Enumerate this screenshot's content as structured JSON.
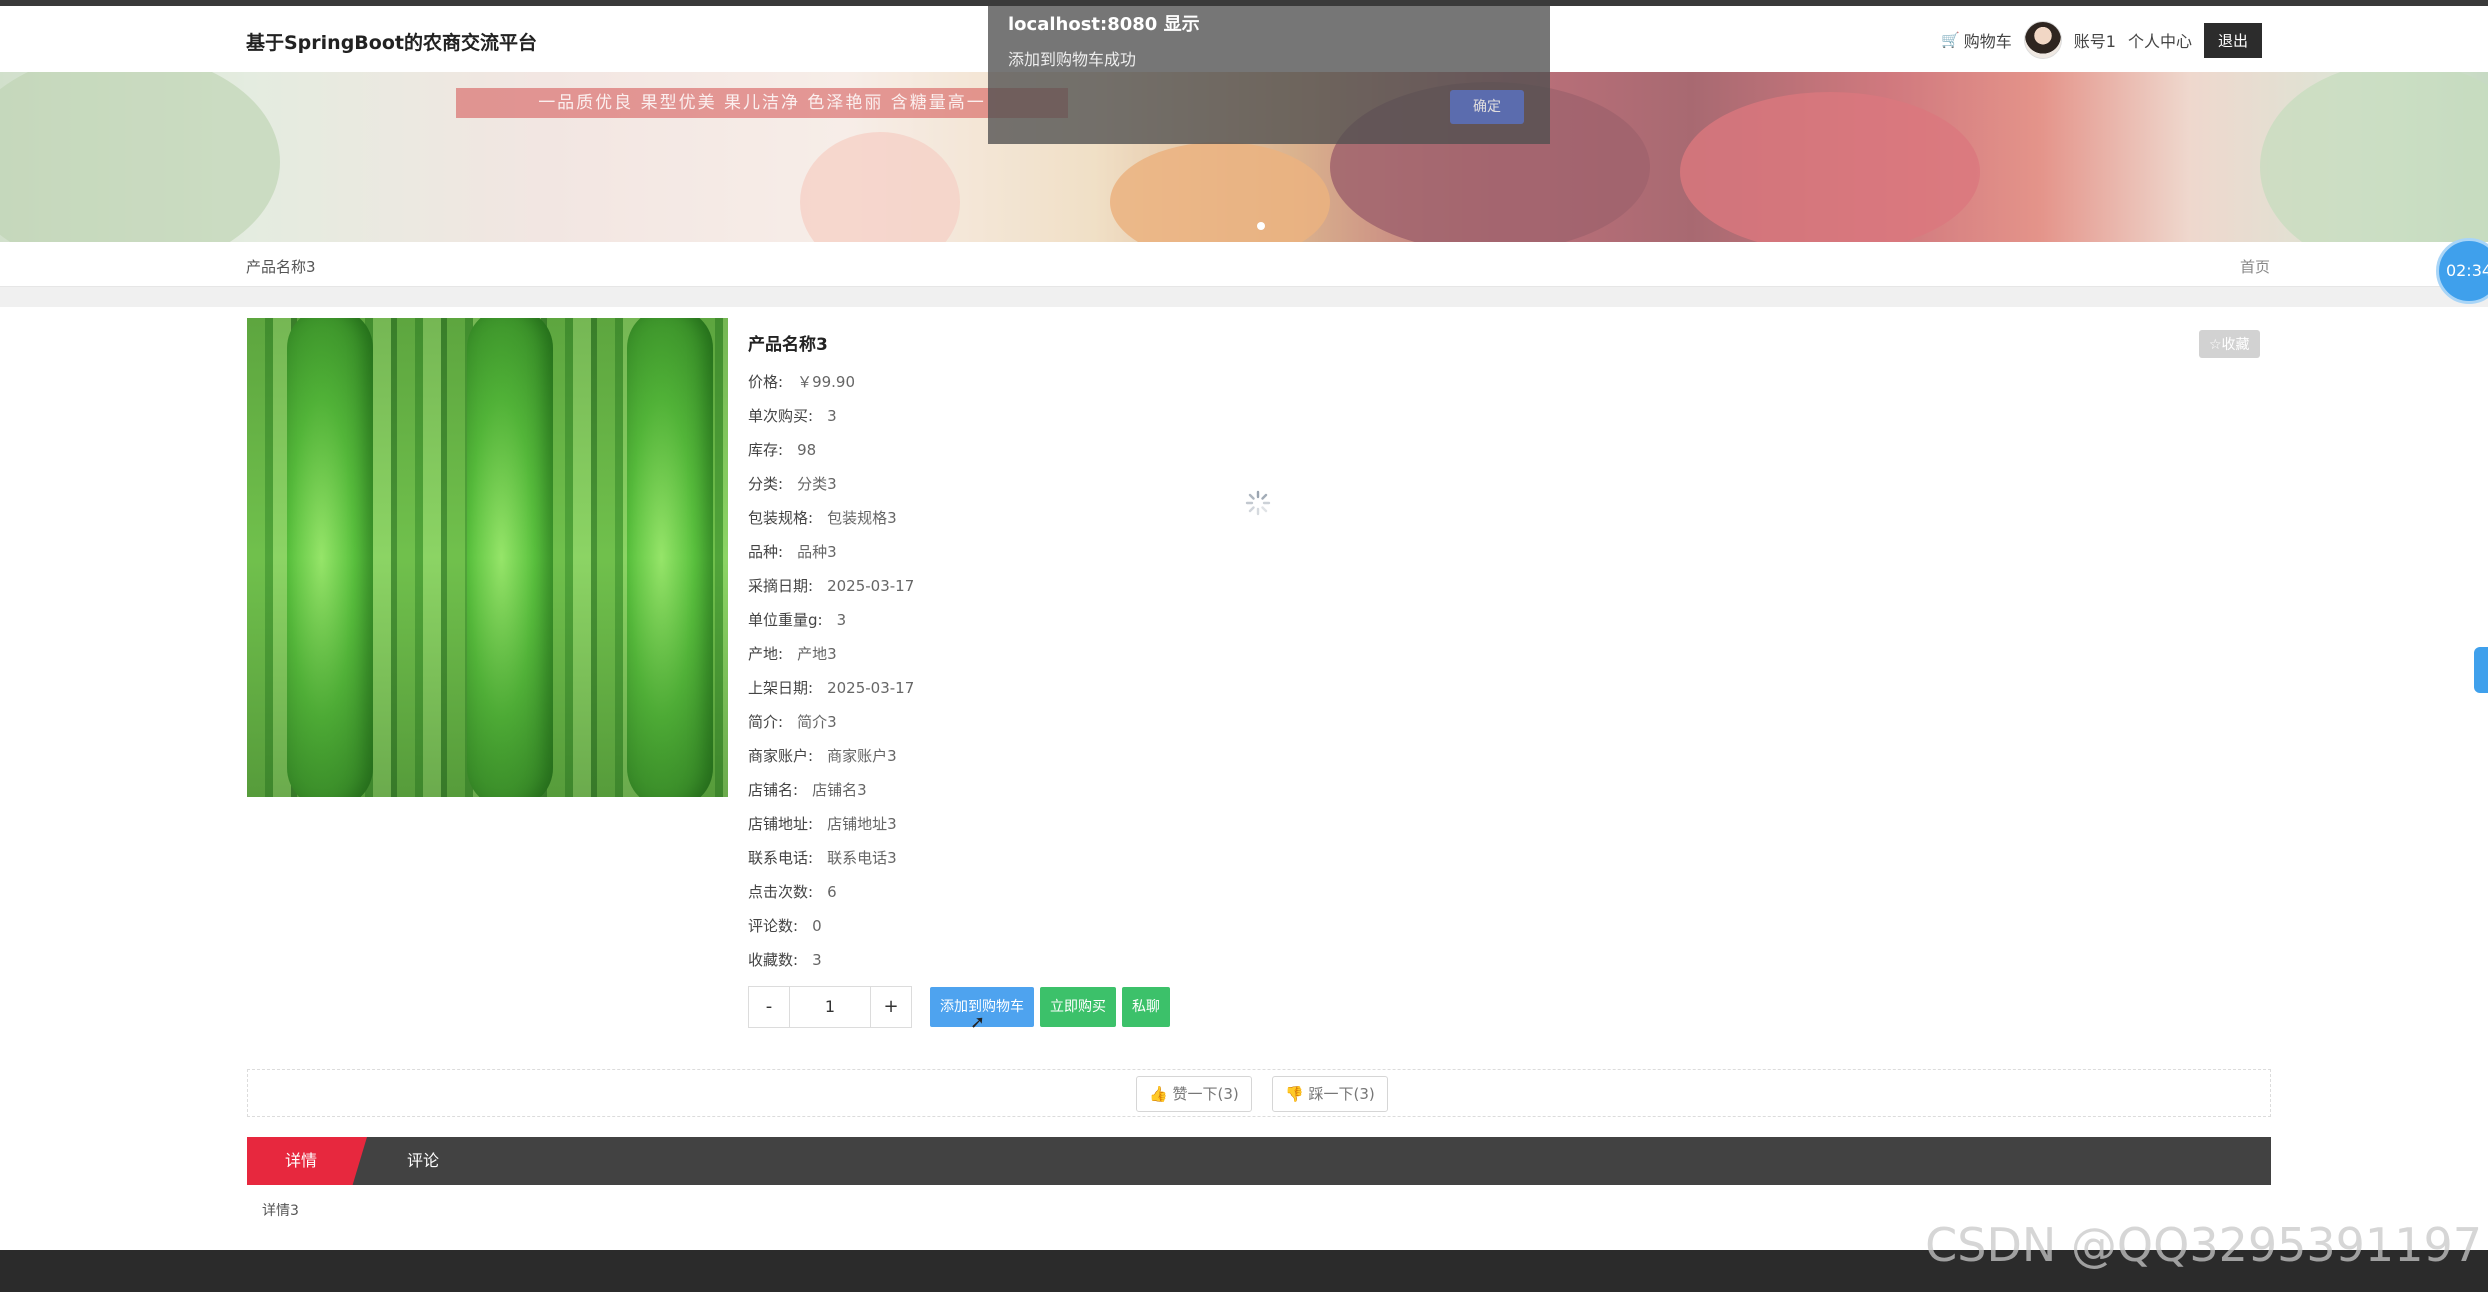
{
  "header": {
    "site_title": "基于SpringBoot的农商交流平台",
    "cart_label": "购物车",
    "username": "账号1",
    "profile_label": "个人中心",
    "logout_label": "退出"
  },
  "banner": {
    "ribbon_text": "一品质优良  果型优美  果儿洁净  色泽艳丽  含糖量高一"
  },
  "breadcrumb": {
    "current": "产品名称3",
    "home": "首页"
  },
  "timer": "02:34",
  "product": {
    "title": "产品名称3",
    "favorite_label": "☆收藏",
    "fields": [
      {
        "label": "价格:",
        "value": "￥99.90"
      },
      {
        "label": "单次购买:",
        "value": "3"
      },
      {
        "label": "库存:",
        "value": "98"
      },
      {
        "label": "分类:",
        "value": "分类3"
      },
      {
        "label": "包装规格:",
        "value": "包装规格3"
      },
      {
        "label": "品种:",
        "value": "品种3"
      },
      {
        "label": "采摘日期:",
        "value": "2025-03-17"
      },
      {
        "label": "单位重量g:",
        "value": "3"
      },
      {
        "label": "产地:",
        "value": "产地3"
      },
      {
        "label": "上架日期:",
        "value": "2025-03-17"
      },
      {
        "label": "简介:",
        "value": "简介3"
      },
      {
        "label": "商家账户:",
        "value": "商家账户3"
      },
      {
        "label": "店铺名:",
        "value": "店铺名3"
      },
      {
        "label": "店铺地址:",
        "value": "店铺地址3"
      },
      {
        "label": "联系电话:",
        "value": "联系电话3"
      },
      {
        "label": "点击次数:",
        "value": "6"
      },
      {
        "label": "评论数:",
        "value": "0"
      },
      {
        "label": "收藏数:",
        "value": "3"
      }
    ]
  },
  "purchase": {
    "minus": "-",
    "quantity": "1",
    "plus": "+",
    "add_to_cart": "添加到购物车",
    "buy_now": "立即购买",
    "chat": "私聊"
  },
  "votes": {
    "like": "赞一下(3)",
    "dislike": "踩一下(3)"
  },
  "tabs": {
    "detail": "详情",
    "comments": "评论",
    "detail_content": "详情3"
  },
  "alert": {
    "title": "localhost:8080 显示",
    "message": "添加到购物车成功",
    "ok": "确定"
  },
  "watermark": "CSDN @QQ3295391197",
  "colors": {
    "accent_blue": "#4ea3ef",
    "accent_green": "#3cc16a",
    "tab_red": "#e7283e",
    "tab_bar": "#424242"
  }
}
